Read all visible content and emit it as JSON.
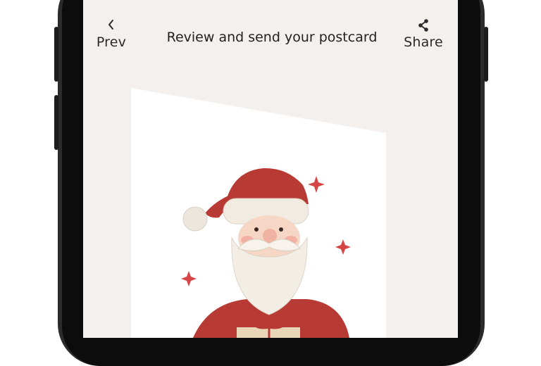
{
  "header": {
    "prev_label": "Prev",
    "title": "Review and send your postcard",
    "share_label": "Share"
  },
  "icons": {
    "prev": "chevron-left-icon",
    "share": "share-icon"
  },
  "colors": {
    "screen_background": "#f3f0ed",
    "santa_red": "#b83a34",
    "sparkle_red": "#d64545",
    "phone_frame": "#0c0c0c"
  }
}
